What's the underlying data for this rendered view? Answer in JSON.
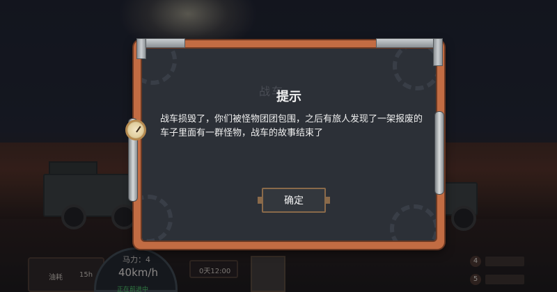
{
  "background": {
    "hud": {
      "left_label": "油耗",
      "left_value": "15h",
      "horsepower": "马力：4",
      "speed": "40km/h",
      "status": "正在前进中",
      "time": "0天12:00",
      "right_numbers": [
        "4",
        "5"
      ]
    },
    "ghost_title": "战车"
  },
  "dialog": {
    "title": "提示",
    "message": "战车损毁了，你们被怪物团团包围，之后有旅人发现了一架报废的车子里面有一群怪物，战车的故事结束了",
    "confirm_label": "确定"
  },
  "colors": {
    "frame": "#c26c43",
    "panel": "#2c3037",
    "status_green": "#4fd36a"
  }
}
